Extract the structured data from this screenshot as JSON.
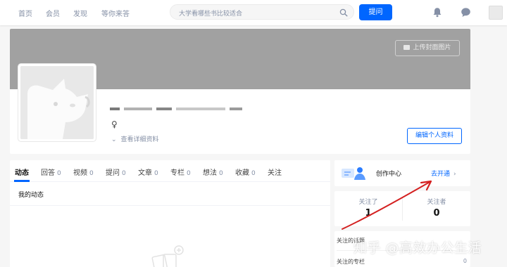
{
  "nav": {
    "items": [
      "首页",
      "会员",
      "发现",
      "等你来答"
    ],
    "search_placeholder": "大学看哪些书比较适合",
    "ask_label": "提问"
  },
  "profile": {
    "upload_cover_label": "上传封面图片",
    "gender_symbol": "♀",
    "detail_label": "查看详细资料",
    "edit_label": "编辑个人资料"
  },
  "tabs": [
    {
      "label": "动态",
      "count": ""
    },
    {
      "label": "回答",
      "count": "0"
    },
    {
      "label": "视频",
      "count": "0"
    },
    {
      "label": "提问",
      "count": "0"
    },
    {
      "label": "文章",
      "count": "0"
    },
    {
      "label": "专栏",
      "count": "0"
    },
    {
      "label": "想法",
      "count": "0"
    },
    {
      "label": "收藏",
      "count": "0"
    },
    {
      "label": "关注",
      "count": ""
    }
  ],
  "activity": {
    "section_title": "我的动态"
  },
  "creator": {
    "label": "创作中心",
    "open_label": "去开通",
    "arrow": "›"
  },
  "follow": {
    "following_label": "关注了",
    "following_count": "1",
    "followers_label": "关注者",
    "followers_count": "0"
  },
  "lists": [
    {
      "label": "关注的话题",
      "value": ""
    },
    {
      "label": "关注的专栏",
      "value": "0"
    }
  ],
  "watermark": "知乎 @高效办公生活",
  "colors": {
    "brand": "#0066ff",
    "cover": "#a1a1a1",
    "annotation": "#d42020"
  },
  "icons": {
    "search": "magnifier",
    "notification": "bell",
    "messages": "chat-bubble",
    "camera": "camera"
  }
}
